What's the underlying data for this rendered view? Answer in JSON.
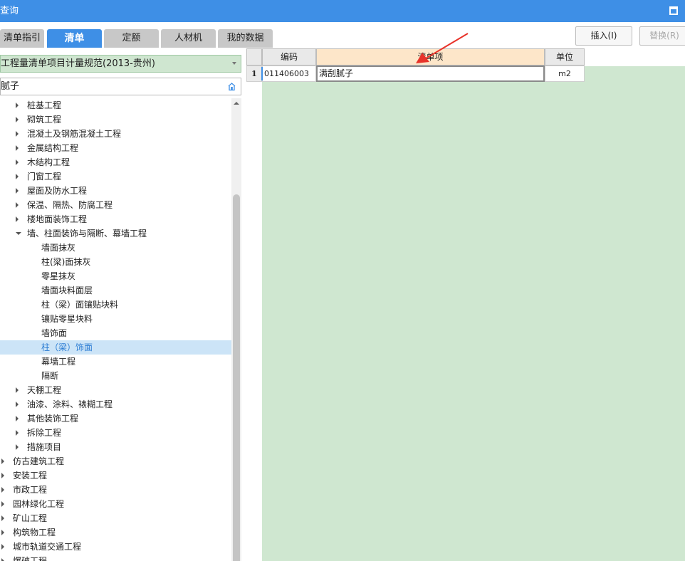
{
  "window": {
    "title": "查询"
  },
  "tabs": [
    {
      "label": "清单指引",
      "active": false
    },
    {
      "label": "清单",
      "active": true
    },
    {
      "label": "定额",
      "active": false
    },
    {
      "label": "人材机",
      "active": false
    },
    {
      "label": "我的数据",
      "active": false
    }
  ],
  "actions": {
    "insert_label": "插入(I)",
    "replace_label": "替换(R)"
  },
  "library": {
    "selected": "工程量清单项目计量规范(2013-贵州)"
  },
  "search": {
    "value": "腻子"
  },
  "tree": [
    {
      "label": "桩基工程",
      "level": 1,
      "state": "closed"
    },
    {
      "label": "砌筑工程",
      "level": 1,
      "state": "closed"
    },
    {
      "label": "混凝土及钢筋混凝土工程",
      "level": 1,
      "state": "closed"
    },
    {
      "label": "金属结构工程",
      "level": 1,
      "state": "closed"
    },
    {
      "label": "木结构工程",
      "level": 1,
      "state": "closed"
    },
    {
      "label": "门窗工程",
      "level": 1,
      "state": "closed"
    },
    {
      "label": "屋面及防水工程",
      "level": 1,
      "state": "closed"
    },
    {
      "label": "保温、隔热、防腐工程",
      "level": 1,
      "state": "closed"
    },
    {
      "label": "楼地面装饰工程",
      "level": 1,
      "state": "closed"
    },
    {
      "label": "墙、柱面装饰与隔断、幕墙工程",
      "level": 1,
      "state": "open"
    },
    {
      "label": "墙面抹灰",
      "level": 2,
      "state": "leaf"
    },
    {
      "label": "柱(梁)面抹灰",
      "level": 2,
      "state": "leaf"
    },
    {
      "label": "零星抹灰",
      "level": 2,
      "state": "leaf"
    },
    {
      "label": "墙面块料面层",
      "level": 2,
      "state": "leaf"
    },
    {
      "label": "柱（梁）面镶贴块料",
      "level": 2,
      "state": "leaf"
    },
    {
      "label": "镶贴零星块料",
      "level": 2,
      "state": "leaf"
    },
    {
      "label": "墙饰面",
      "level": 2,
      "state": "leaf"
    },
    {
      "label": "柱（梁）饰面",
      "level": 2,
      "state": "leaf",
      "selected": true
    },
    {
      "label": "幕墙工程",
      "level": 2,
      "state": "leaf"
    },
    {
      "label": "隔断",
      "level": 2,
      "state": "leaf"
    },
    {
      "label": "天棚工程",
      "level": 1,
      "state": "closed"
    },
    {
      "label": "油漆、涂料、裱糊工程",
      "level": 1,
      "state": "closed"
    },
    {
      "label": "其他装饰工程",
      "level": 1,
      "state": "closed"
    },
    {
      "label": "拆除工程",
      "level": 1,
      "state": "closed"
    },
    {
      "label": "措施项目",
      "level": 1,
      "state": "closed"
    },
    {
      "label": "仿古建筑工程",
      "level": 0,
      "state": "closed"
    },
    {
      "label": "安装工程",
      "level": 0,
      "state": "closed"
    },
    {
      "label": "市政工程",
      "level": 0,
      "state": "closed"
    },
    {
      "label": "园林绿化工程",
      "level": 0,
      "state": "closed"
    },
    {
      "label": "矿山工程",
      "level": 0,
      "state": "closed"
    },
    {
      "label": "构筑物工程",
      "level": 0,
      "state": "closed"
    },
    {
      "label": "城市轨道交通工程",
      "level": 0,
      "state": "closed"
    },
    {
      "label": "爆破工程",
      "level": 0,
      "state": "closed"
    }
  ],
  "grid": {
    "columns": {
      "code": "编码",
      "item": "清单项",
      "unit": "单位"
    },
    "rows": [
      {
        "index": "1",
        "code": "011406003",
        "item": "满刮腻子",
        "unit": "m2"
      }
    ]
  },
  "colors": {
    "accent": "#3e8fe6",
    "grid_bg": "#cfe7d0",
    "selected_header": "#fde6c9",
    "annotation_arrow": "#e8332a"
  }
}
